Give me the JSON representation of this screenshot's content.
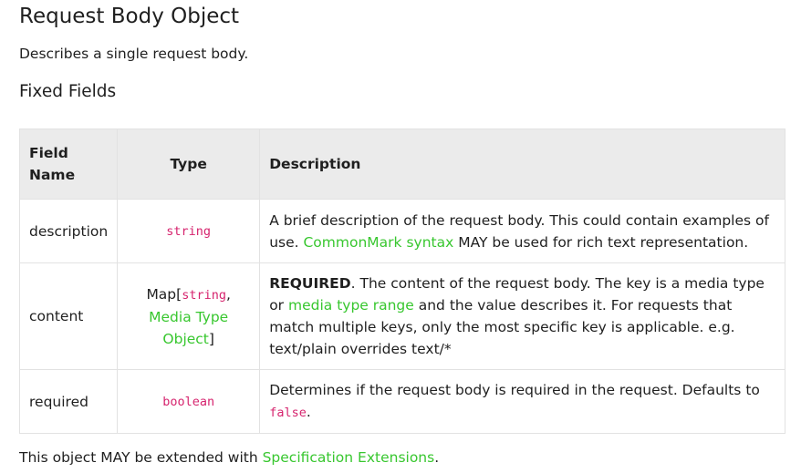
{
  "heading": "Request Body Object",
  "intro": "Describes a single request body.",
  "subheading": "Fixed Fields",
  "table": {
    "headers": {
      "field": "Field Name",
      "type": "Type",
      "description": "Description"
    },
    "rows": [
      {
        "field": "description",
        "type_code": "string",
        "desc_1": "A brief description of the request body. This could contain examples of use. ",
        "desc_link": "CommonMark syntax",
        "desc_2": " MAY be used for rich text representation."
      },
      {
        "field": "content",
        "type_prefix": "Map[",
        "type_code": "string",
        "type_sep": ", ",
        "type_link": "Media Type Object",
        "type_suffix": "]",
        "desc_strong": "REQUIRED",
        "desc_1": ". The content of the request body. The key is a media type or ",
        "desc_link": "media type range",
        "desc_2": " and the value describes it. For requests that match multiple keys, only the most specific key is applicable. e.g. text/plain overrides text/*"
      },
      {
        "field": "required",
        "type_code": "boolean",
        "desc_1": "Determines if the request body is required in the request. Defaults to ",
        "desc_code": "false",
        "desc_2": "."
      }
    ]
  },
  "footer": {
    "text_1": "This object MAY be extended with ",
    "link": "Specification Extensions",
    "text_2": "."
  },
  "colors": {
    "link": "#38c72f",
    "code": "#d6246e",
    "header_bg": "#ebebeb"
  }
}
